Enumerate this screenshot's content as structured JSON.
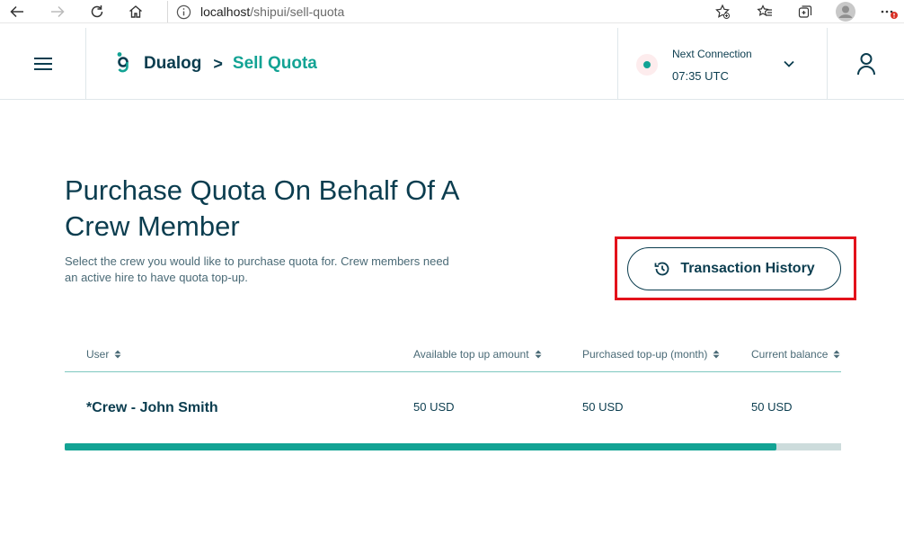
{
  "browser": {
    "url_host": "localhost",
    "url_path": "/shipui/sell-quota"
  },
  "header": {
    "brand": "Dualog",
    "breadcrumb_sep": ">",
    "current_page": "Sell Quota",
    "connection_label": "Next Connection",
    "connection_time": "07:35 UTC"
  },
  "main": {
    "title": "Purchase Quota On Behalf Of A Crew Member",
    "description": "Select the crew you would like to purchase quota for. Crew members need an active hire to have quota top-up.",
    "transaction_history_label": "Transaction History"
  },
  "table": {
    "columns": [
      "User",
      "Available top up amount",
      "Purchased top-up (month)",
      "Current balance"
    ],
    "rows": [
      {
        "user": "*Crew - John Smith",
        "available": "50 USD",
        "purchased": "50 USD",
        "balance": "50 USD"
      }
    ],
    "scroll_progress": 0.917
  },
  "colors": {
    "accent": "#13a394",
    "text": "#0b3d4f",
    "highlight": "#e3121b"
  }
}
